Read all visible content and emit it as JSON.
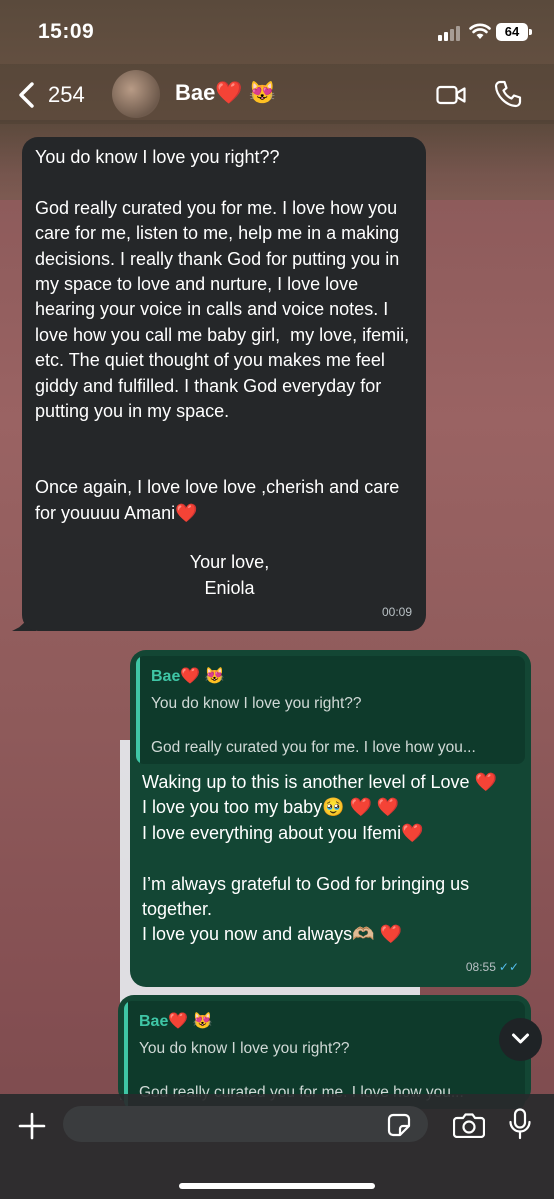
{
  "status_bar": {
    "time": "15:09",
    "battery": "64"
  },
  "header": {
    "back_count": "254",
    "contact_name": "Bae❤️ 😻"
  },
  "messages": {
    "incoming": {
      "text": "You do know I love you right??\n\nGod really curated you for me. I love how you care for me, listen to me, help me in a making decisions. I really thank God for putting you in my space to love and nurture, I love love hearing your voice in calls and voice notes. I love how you call me baby girl,  my love, ifemii, etc. The quiet thought of you makes me feel giddy and fulfilled. I thank God everyday for putting you in my space.\n\n\nOnce again, I love love love ,cherish and care for youuuu Amani❤️",
      "signature_line1": "Your love,",
      "signature_line2": "Eniola",
      "time": "00:09"
    },
    "outgoing": {
      "quote_name": "Bae❤️ 😻",
      "quote_text": "You do know I love you right??\n\nGod really curated you for me. I love how you...",
      "text": "Waking up to this is another level of Love ❤️\nI love you too my baby🥹 ❤️ ❤️\nI love everything about you Ifemi❤️\n\nI’m always grateful to God for bringing us together.\nI love you now and always🫶🏼 ❤️",
      "time": "08:55",
      "ticks": "✓✓"
    },
    "outgoing_partial": {
      "quote_name": "Bae❤️ 😻",
      "quote_text": "You do know I love you right??\n\nGod really curated you for me. I love how you..."
    }
  },
  "colors": {
    "incoming_bubble": "#252729",
    "outgoing_bubble": "#134634",
    "quote_accent": "#3fc6a6",
    "read_ticks": "#53bdeb"
  }
}
